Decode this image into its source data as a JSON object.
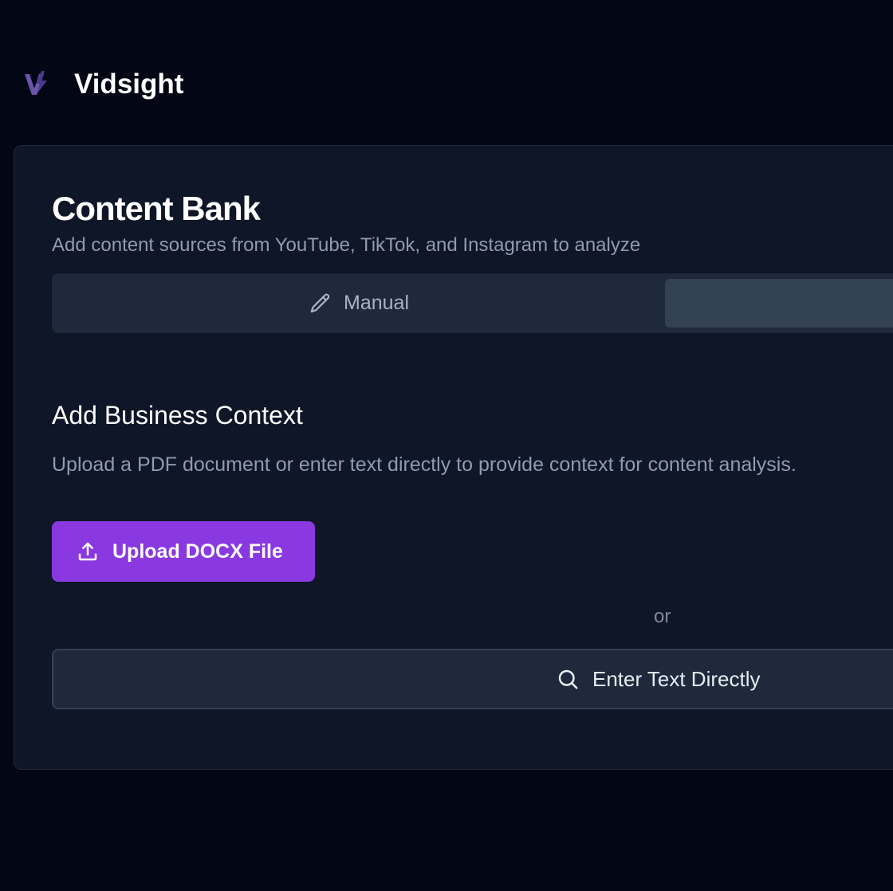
{
  "brand": {
    "name": "Vidsight",
    "logo_icon": "vidsight-logo-icon",
    "logo_color": "#6a55a8"
  },
  "content_bank": {
    "title": "Content Bank",
    "subtitle": "Add content sources from YouTube, TikTok, and Instagram to analyze",
    "tabs": [
      {
        "label": "Manual",
        "icon": "pencil-icon",
        "active": false
      },
      {
        "label": "",
        "active": true
      }
    ]
  },
  "business_context": {
    "title": "Add Business Context",
    "description": "Upload a PDF document or enter text directly to provide context for content analysis.",
    "upload_button": {
      "label": "Upload DOCX File",
      "icon": "upload-icon",
      "color": "#8a38e0"
    },
    "divider_text": "or",
    "text_button": {
      "label": "Enter Text Directly",
      "icon": "search-icon"
    }
  },
  "colors": {
    "background": "#030614",
    "card": "#0e1628",
    "tab_bar": "#1e293b",
    "tab_active": "#334155",
    "accent": "#8a38e0"
  }
}
